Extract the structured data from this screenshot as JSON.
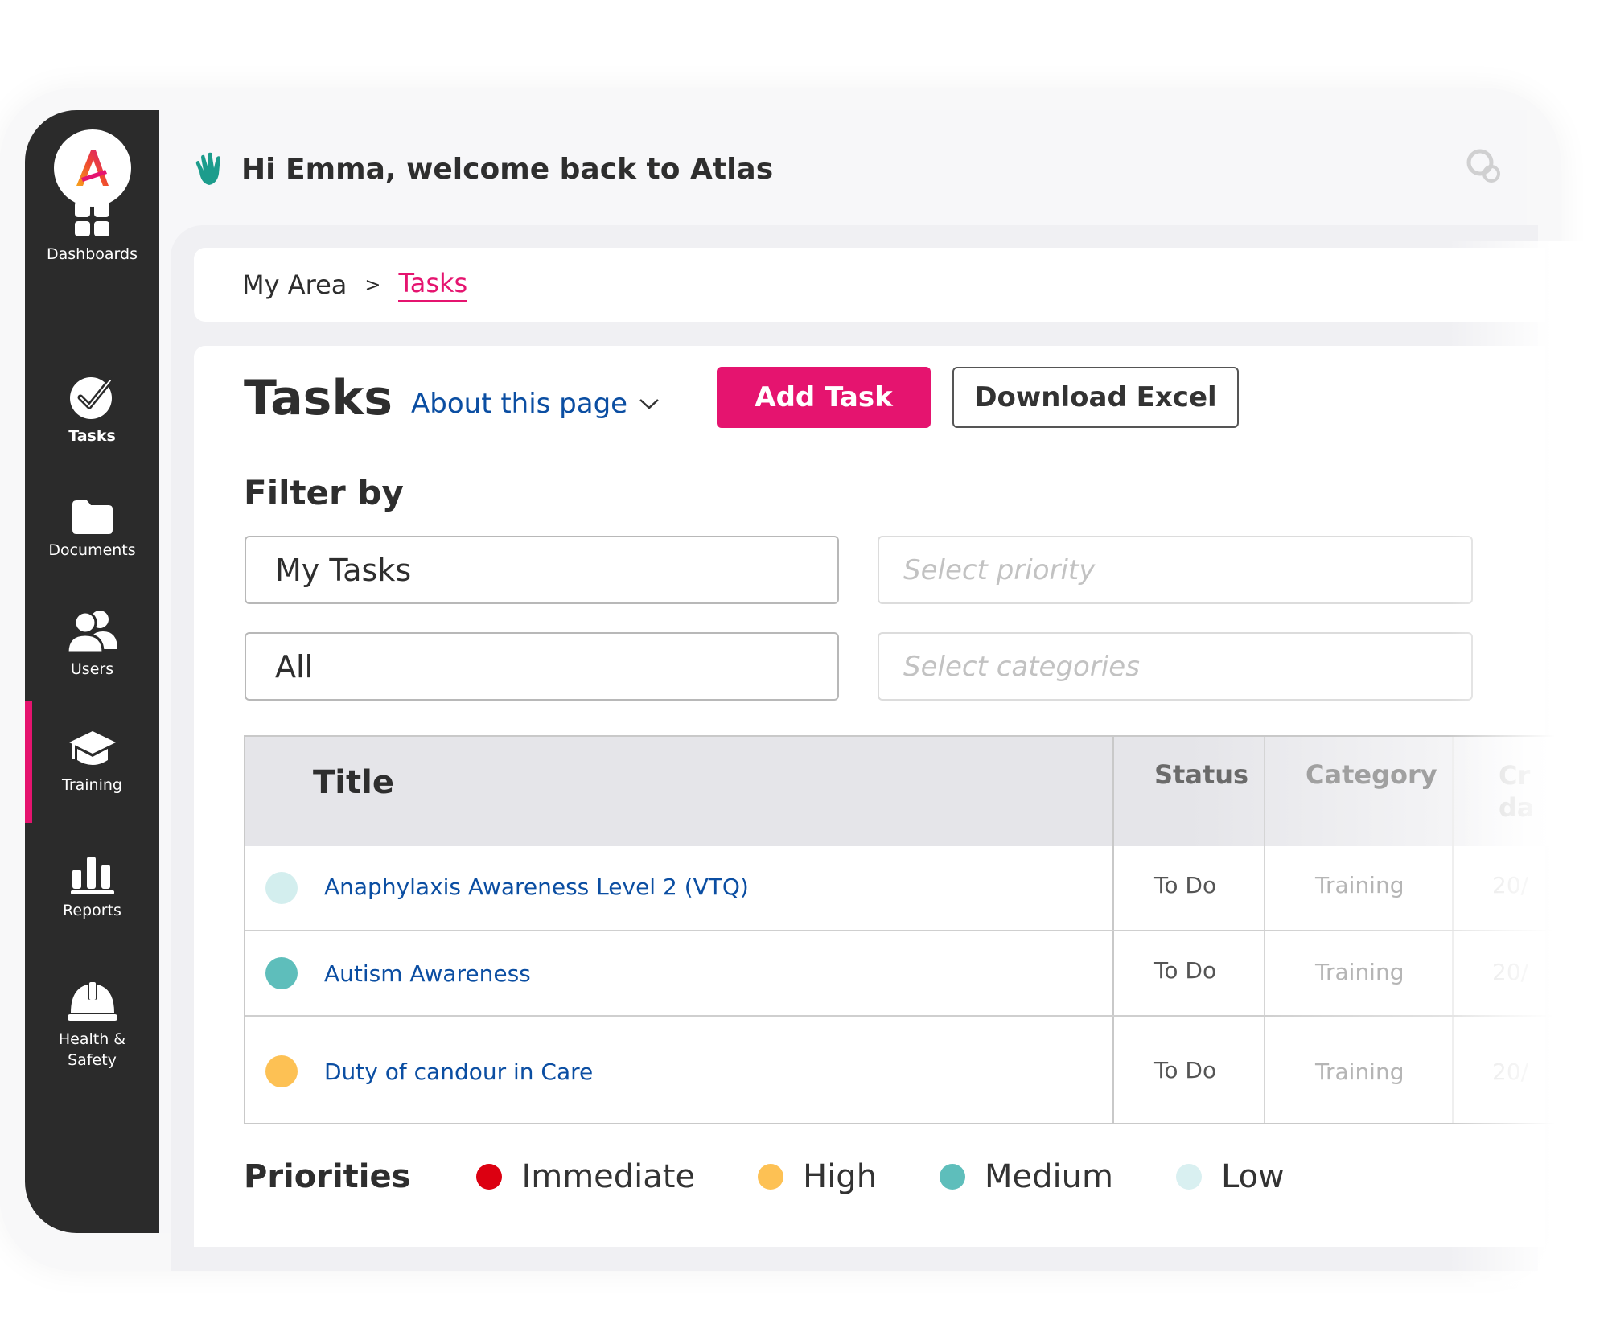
{
  "header": {
    "greeting": "Hi Emma, welcome back to Atlas"
  },
  "sidebar": {
    "items": [
      {
        "label": "Dashboards",
        "icon": "dashboard-grid-icon"
      },
      {
        "label": "Tasks",
        "icon": "checkmark-circle-icon",
        "active": true
      },
      {
        "label": "Documents",
        "icon": "folder-icon"
      },
      {
        "label": "Users",
        "icon": "users-icon"
      },
      {
        "label": "Training",
        "icon": "graduation-cap-icon"
      },
      {
        "label": "Reports",
        "icon": "bar-chart-icon"
      },
      {
        "label": "Health &",
        "label2": "Safety",
        "icon": "hard-hat-icon"
      }
    ]
  },
  "breadcrumb": {
    "root": "My Area",
    "separator": ">",
    "current": "Tasks"
  },
  "page": {
    "title": "Tasks",
    "about": "About this page",
    "add_button": "Add Task",
    "download_button": "Download Excel"
  },
  "filters": {
    "label": "Filter by",
    "assignee_value": "My Tasks",
    "priority_placeholder": "Select priority",
    "status_value": "All",
    "categories_placeholder": "Select categories"
  },
  "table": {
    "columns": {
      "title": "Title",
      "status": "Status",
      "category": "Category",
      "created": "Cr",
      "created2": "da"
    },
    "rows": [
      {
        "title": "Anaphylaxis Awareness Level 2 (VTQ)",
        "status": "To Do",
        "category": "Training",
        "created": "20/",
        "priority": "Low",
        "color": "#d3eeee"
      },
      {
        "title": "Autism Awareness",
        "status": "To Do",
        "category": "Training",
        "created": "20/",
        "priority": "Medium",
        "color": "#5ebebb"
      },
      {
        "title": "Duty of candour in Care",
        "status": "To Do",
        "category": "Training",
        "created": "20/",
        "priority": "High",
        "color": "#fdc154"
      }
    ]
  },
  "legend": {
    "title": "Priorities",
    "items": [
      {
        "label": "Immediate",
        "color": "#dc0011"
      },
      {
        "label": "High",
        "color": "#fdc154"
      },
      {
        "label": "Medium",
        "color": "#5ebebb"
      },
      {
        "label": "Low",
        "color": "#d9f0f1"
      }
    ]
  },
  "colors": {
    "accent": "#e5146f",
    "link": "#0b4ea2",
    "sidebar": "#2b2b2b"
  }
}
